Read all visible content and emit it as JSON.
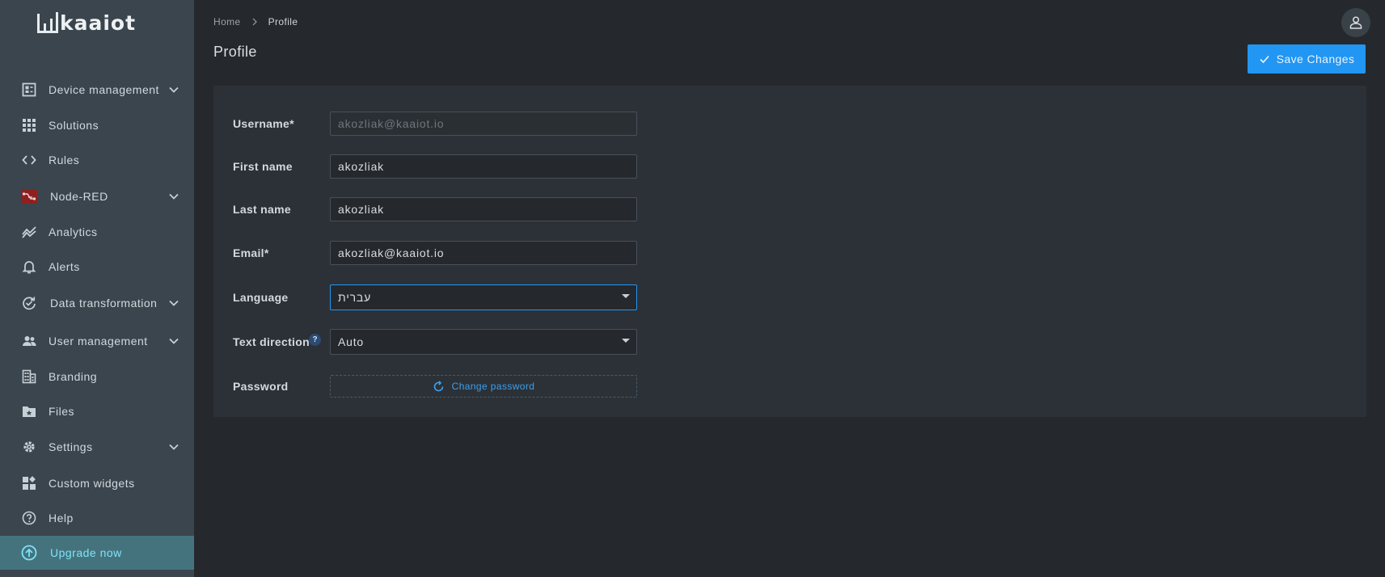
{
  "app": {
    "logo_text": "kaaiot"
  },
  "sidebar": {
    "items": [
      {
        "label": "Device management",
        "icon": "device-management-icon",
        "expandable": true
      },
      {
        "label": "Solutions",
        "icon": "grid-icon",
        "expandable": false
      },
      {
        "label": "Rules",
        "icon": "code-icon",
        "expandable": false
      },
      {
        "label": "Node-RED",
        "icon": "node-red-icon",
        "expandable": true
      },
      {
        "label": "Analytics",
        "icon": "analytics-icon",
        "expandable": false
      },
      {
        "label": "Alerts",
        "icon": "bell-icon",
        "expandable": false
      },
      {
        "label": "Data transformation",
        "icon": "data-transformation-icon",
        "expandable": true
      },
      {
        "label": "User management",
        "icon": "users-icon",
        "expandable": true
      },
      {
        "label": "Branding",
        "icon": "building-icon",
        "expandable": false
      },
      {
        "label": "Files",
        "icon": "folder-icon",
        "expandable": false
      },
      {
        "label": "Settings",
        "icon": "gear-icon",
        "expandable": true
      },
      {
        "label": "Custom widgets",
        "icon": "widgets-icon",
        "expandable": false
      },
      {
        "label": "Help",
        "icon": "help-icon",
        "expandable": false
      },
      {
        "label": "Upgrade now",
        "icon": "upgrade-icon",
        "expandable": false
      }
    ]
  },
  "breadcrumb": {
    "home": "Home",
    "current": "Profile"
  },
  "page": {
    "title": "Profile",
    "save_label": "Save Changes"
  },
  "form": {
    "username": {
      "label": "Username*",
      "value": "akozliak@kaaiot.io"
    },
    "first_name": {
      "label": "First name",
      "value": "akozliak"
    },
    "last_name": {
      "label": "Last name",
      "value": "akozliak"
    },
    "email": {
      "label": "Email*",
      "value": "akozliak@kaaiot.io"
    },
    "language": {
      "label": "Language",
      "value": "עברית"
    },
    "text_direction": {
      "label": "Text direction",
      "value": "Auto",
      "help": "?"
    },
    "password": {
      "label": "Password",
      "button": "Change password"
    }
  },
  "colors": {
    "accent": "#2196f3",
    "sidebar": "#3a454d",
    "background": "#25292e",
    "upgrade": "#44737e"
  }
}
